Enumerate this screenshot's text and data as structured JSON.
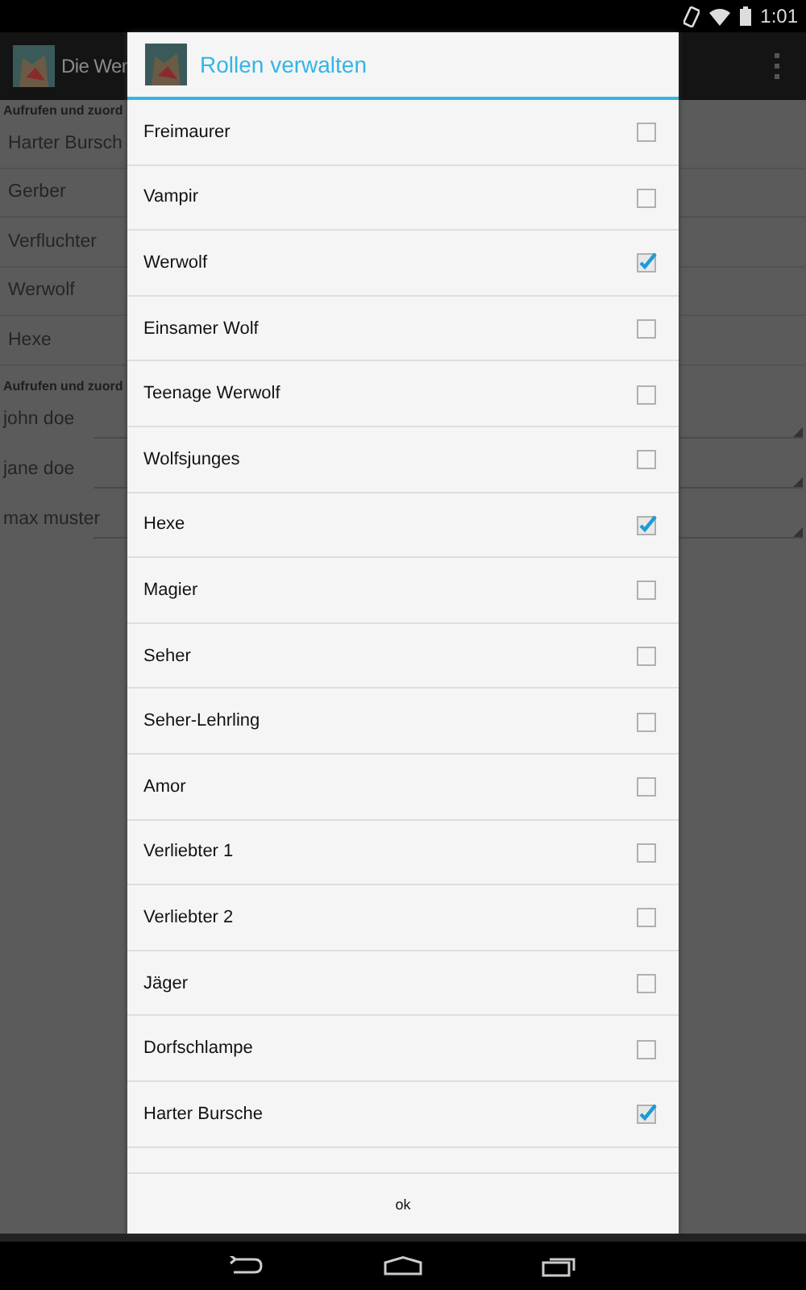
{
  "status_bar": {
    "time": "1:01"
  },
  "action_bar": {
    "title": "Die Wer"
  },
  "background": {
    "sections": [
      {
        "kind": "roles",
        "header": "Aufrufen und zuord",
        "items": [
          "Harter Bursch",
          "Gerber",
          "Verfluchter",
          "Werwolf",
          "Hexe"
        ]
      },
      {
        "kind": "players",
        "header": "Aufrufen und zuord",
        "items": [
          "john doe",
          "jane doe",
          "max muster"
        ]
      }
    ]
  },
  "dialog": {
    "title": "Rollen verwalten",
    "roles": [
      {
        "label": "Freimaurer",
        "checked": false
      },
      {
        "label": "Vampir",
        "checked": false
      },
      {
        "label": "Werwolf",
        "checked": true
      },
      {
        "label": "Einsamer Wolf",
        "checked": false
      },
      {
        "label": "Teenage Werwolf",
        "checked": false
      },
      {
        "label": "Wolfsjunges",
        "checked": false
      },
      {
        "label": "Hexe",
        "checked": true
      },
      {
        "label": "Magier",
        "checked": false
      },
      {
        "label": "Seher",
        "checked": false
      },
      {
        "label": "Seher-Lehrling",
        "checked": false
      },
      {
        "label": "Amor",
        "checked": false
      },
      {
        "label": "Verliebter 1",
        "checked": false
      },
      {
        "label": "Verliebter 2",
        "checked": false
      },
      {
        "label": "Jäger",
        "checked": false
      },
      {
        "label": "Dorfschlampe",
        "checked": false
      },
      {
        "label": "Harter Bursche",
        "checked": true
      }
    ],
    "buttons": [
      "ok"
    ]
  }
}
